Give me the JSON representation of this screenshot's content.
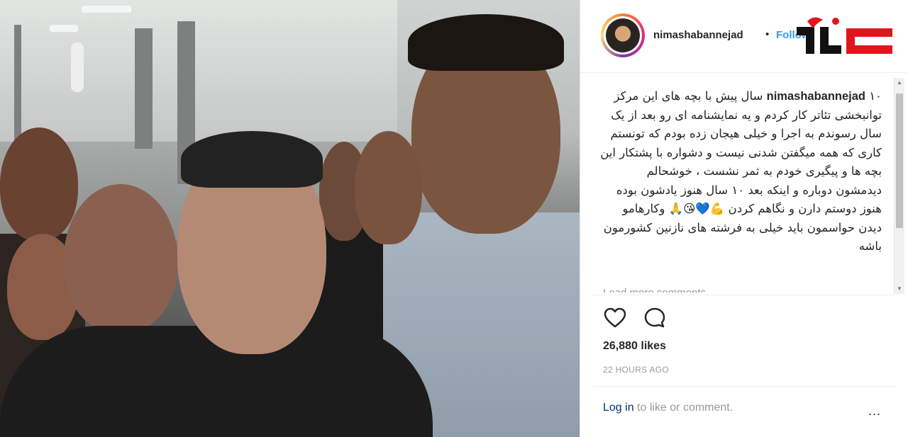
{
  "post": {
    "username": "nimashabannejad",
    "separator": "•",
    "follow_label": "Follow",
    "caption_username": "nimashabannejad",
    "caption_text": "۱۰ سال پیش با بچه های این مرکز توانبخشی تئاتر کار کردم و یه نمایشنامه ای رو بعد از یک سال رسوندم به اجرا و خیلی هیجان زده بودم که تونستم کاری که همه میگفتن شدنی نیست و دشواره با پشتکار این بچه ها و پیگیری خودم به ثمر نشست ، خوشحالم دیدمشون دوباره و اینکه بعد ۱۰ سال هنوز یادشون بوده هنوز دوستم دارن و نگاهم کردن 💪💙😘🙏 وکارهامو دیدن حواسمون باید خیلی به فرشته های نازنین کشورمون باشه",
    "load_more": "Load more comments",
    "likes": "26,880 likes",
    "timestamp": "22 HOURS AGO",
    "login_link": "Log in",
    "login_rest": " to like or comment.",
    "more_icon": "..."
  },
  "icons": {
    "like": "heart-icon",
    "comment": "comment-icon",
    "more": "more-options-icon"
  },
  "colors": {
    "follow": "#3897f0",
    "link": "#003569",
    "text": "#262626",
    "muted": "#999999",
    "watermark_red": "#e0161d"
  }
}
